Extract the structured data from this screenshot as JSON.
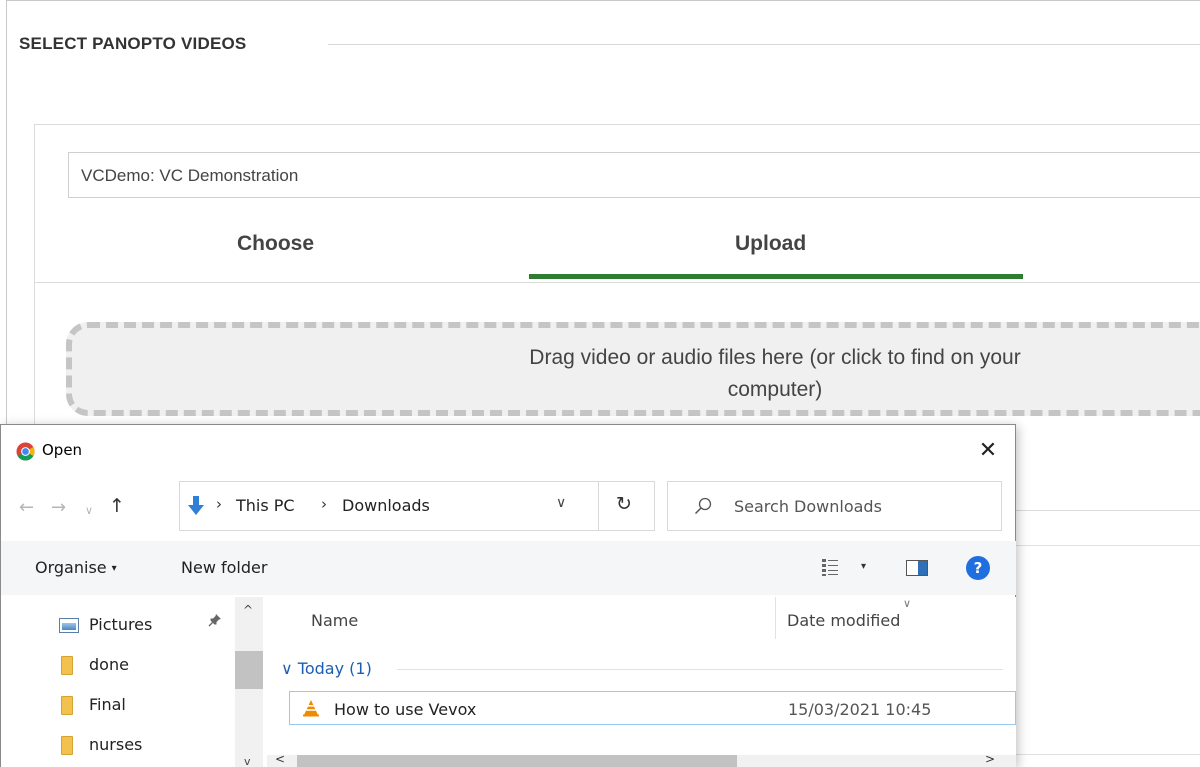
{
  "panopto": {
    "section_title": "SELECT PANOPTO VIDEOS",
    "folder_value": "VCDemo: VC Demonstration",
    "tabs": [
      {
        "label": "Choose",
        "active": false
      },
      {
        "label": "Upload",
        "active": true
      }
    ],
    "dropzone_text_line1": "Drag video or audio files here (or click to find on your",
    "dropzone_text_line2": "computer)",
    "accent_color": "#2e7d32"
  },
  "dialog": {
    "title": "Open",
    "app_icon": "chrome-icon",
    "close_glyph": "✕",
    "nav": {
      "back_glyph": "←",
      "forward_glyph": "→",
      "recent_glyph": "∨",
      "up_glyph": "↑"
    },
    "address": {
      "crumbs": [
        "This PC",
        "Downloads"
      ],
      "separator": "›",
      "dropdown_glyph": "∨",
      "refresh_glyph": "↻"
    },
    "search": {
      "placeholder": "Search Downloads"
    },
    "toolbar": {
      "organise_label": "Organise",
      "organise_arrow": "▾",
      "new_folder_label": "New folder",
      "view_arrow": "▾",
      "help_label": "?"
    },
    "nav_pane": {
      "items": [
        {
          "label": "Pictures",
          "icon": "pictures-icon",
          "pinned": true
        },
        {
          "label": "done",
          "icon": "folder-icon"
        },
        {
          "label": "Final",
          "icon": "folder-icon"
        },
        {
          "label": "nurses",
          "icon": "folder-icon"
        }
      ],
      "pin_glyph": "📌",
      "scroll_up_glyph": "^",
      "scroll_down_glyph": "v"
    },
    "files": {
      "columns": {
        "name": "Name",
        "date": "Date modified"
      },
      "sort_glyph": "∨",
      "group_label": "∨  Today (1)",
      "rows": [
        {
          "name": "How to use Vevox",
          "date": "15/03/2021 10:45",
          "icon": "vlc-icon"
        }
      ],
      "hscroll_left": "<",
      "hscroll_right": ">"
    }
  }
}
